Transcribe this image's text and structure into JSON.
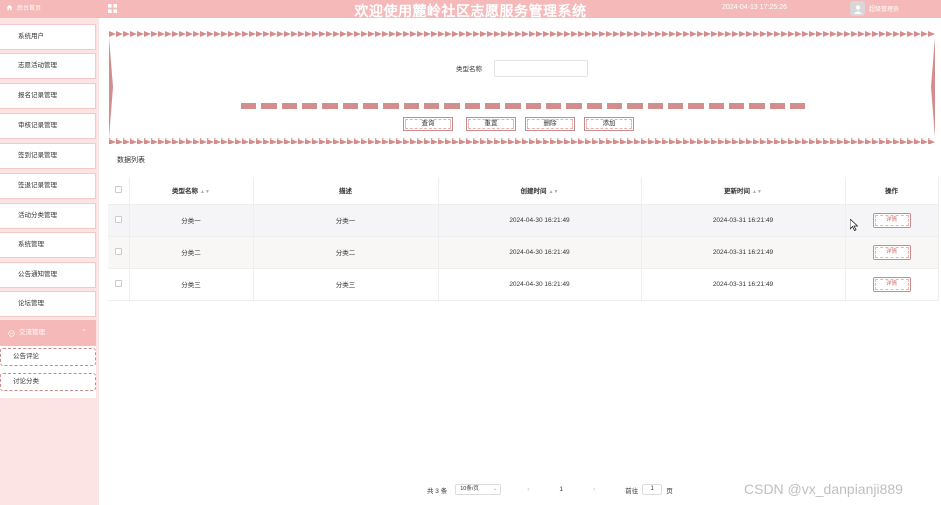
{
  "header": {
    "home_label": "后台首页",
    "title": "欢迎使用麓岭社区志愿服务管理系统",
    "datetime": "2024-04-13 17:25:26",
    "user_name": "超级管理员"
  },
  "sidebar": {
    "items": [
      {
        "label": "系统用户"
      },
      {
        "label": "志愿活动管理"
      },
      {
        "label": "报名记录管理"
      },
      {
        "label": "审核记录管理"
      },
      {
        "label": "签到记录管理"
      },
      {
        "label": "签退记录管理"
      },
      {
        "label": "活动分类管理"
      },
      {
        "label": "系统管理"
      },
      {
        "label": "公告通知管理"
      },
      {
        "label": "论坛管理"
      }
    ],
    "group": {
      "label": "交流管理",
      "sub_items": [
        {
          "label": "公告评论"
        },
        {
          "label": "讨论分类"
        }
      ]
    }
  },
  "search": {
    "label": "类型名称",
    "value": "",
    "placeholder": "",
    "buttons": {
      "query": "查询",
      "reset": "重置",
      "delete": "删除",
      "add": "添加"
    }
  },
  "list": {
    "title": "数据列表",
    "columns": {
      "name": "类型名称",
      "desc": "描述",
      "created": "创建时间",
      "updated": "更新时间",
      "action": "操作"
    },
    "rows": [
      {
        "name": "分类一",
        "desc": "分类一",
        "created": "2024-04-30 16:21:49",
        "updated": "2024-03-31 16:21:49",
        "action": "详情"
      },
      {
        "name": "分类二",
        "desc": "分类二",
        "created": "2024-04-30 16:21:49",
        "updated": "2024-03-31 16:21:49",
        "action": "详情"
      },
      {
        "name": "分类三",
        "desc": "分类三",
        "created": "2024-04-30 16:21:49",
        "updated": "2024-03-31 16:21:49",
        "action": "详情"
      }
    ]
  },
  "pager": {
    "total": "共 3 条",
    "page_size": "10条/页",
    "current": "1",
    "goto_label": "前往",
    "goto_value": "1",
    "page_unit": "页"
  },
  "watermark": "CSDN @vx_danpianji889",
  "colors": {
    "primary": "#f5b9b9",
    "accent": "#c98a8a",
    "background": "#fde4e4"
  }
}
